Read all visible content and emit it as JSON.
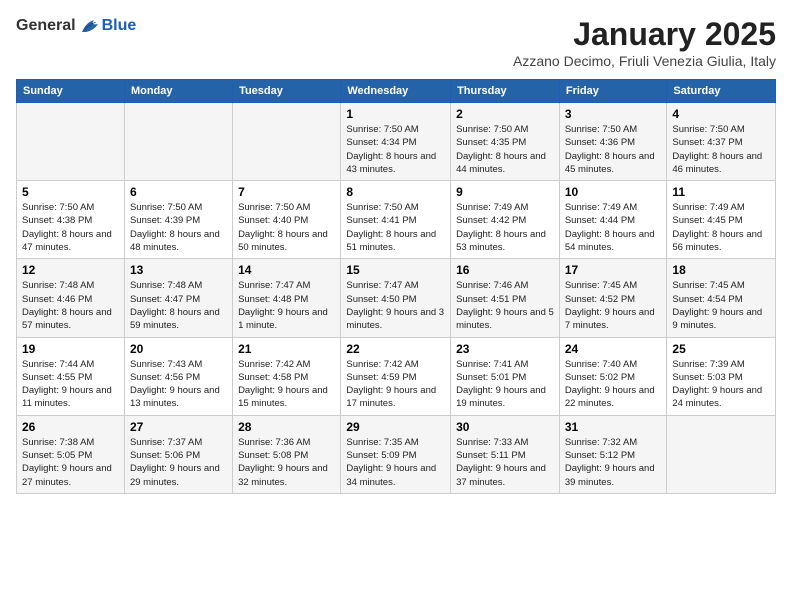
{
  "header": {
    "logo_general": "General",
    "logo_blue": "Blue",
    "month_title": "January 2025",
    "location": "Azzano Decimo, Friuli Venezia Giulia, Italy"
  },
  "weekdays": [
    "Sunday",
    "Monday",
    "Tuesday",
    "Wednesday",
    "Thursday",
    "Friday",
    "Saturday"
  ],
  "weeks": [
    [
      {
        "date": "",
        "info": ""
      },
      {
        "date": "",
        "info": ""
      },
      {
        "date": "",
        "info": ""
      },
      {
        "date": "1",
        "info": "Sunrise: 7:50 AM\nSunset: 4:34 PM\nDaylight: 8 hours and 43 minutes."
      },
      {
        "date": "2",
        "info": "Sunrise: 7:50 AM\nSunset: 4:35 PM\nDaylight: 8 hours and 44 minutes."
      },
      {
        "date": "3",
        "info": "Sunrise: 7:50 AM\nSunset: 4:36 PM\nDaylight: 8 hours and 45 minutes."
      },
      {
        "date": "4",
        "info": "Sunrise: 7:50 AM\nSunset: 4:37 PM\nDaylight: 8 hours and 46 minutes."
      }
    ],
    [
      {
        "date": "5",
        "info": "Sunrise: 7:50 AM\nSunset: 4:38 PM\nDaylight: 8 hours and 47 minutes."
      },
      {
        "date": "6",
        "info": "Sunrise: 7:50 AM\nSunset: 4:39 PM\nDaylight: 8 hours and 48 minutes."
      },
      {
        "date": "7",
        "info": "Sunrise: 7:50 AM\nSunset: 4:40 PM\nDaylight: 8 hours and 50 minutes."
      },
      {
        "date": "8",
        "info": "Sunrise: 7:50 AM\nSunset: 4:41 PM\nDaylight: 8 hours and 51 minutes."
      },
      {
        "date": "9",
        "info": "Sunrise: 7:49 AM\nSunset: 4:42 PM\nDaylight: 8 hours and 53 minutes."
      },
      {
        "date": "10",
        "info": "Sunrise: 7:49 AM\nSunset: 4:44 PM\nDaylight: 8 hours and 54 minutes."
      },
      {
        "date": "11",
        "info": "Sunrise: 7:49 AM\nSunset: 4:45 PM\nDaylight: 8 hours and 56 minutes."
      }
    ],
    [
      {
        "date": "12",
        "info": "Sunrise: 7:48 AM\nSunset: 4:46 PM\nDaylight: 8 hours and 57 minutes."
      },
      {
        "date": "13",
        "info": "Sunrise: 7:48 AM\nSunset: 4:47 PM\nDaylight: 8 hours and 59 minutes."
      },
      {
        "date": "14",
        "info": "Sunrise: 7:47 AM\nSunset: 4:48 PM\nDaylight: 9 hours and 1 minute."
      },
      {
        "date": "15",
        "info": "Sunrise: 7:47 AM\nSunset: 4:50 PM\nDaylight: 9 hours and 3 minutes."
      },
      {
        "date": "16",
        "info": "Sunrise: 7:46 AM\nSunset: 4:51 PM\nDaylight: 9 hours and 5 minutes."
      },
      {
        "date": "17",
        "info": "Sunrise: 7:45 AM\nSunset: 4:52 PM\nDaylight: 9 hours and 7 minutes."
      },
      {
        "date": "18",
        "info": "Sunrise: 7:45 AM\nSunset: 4:54 PM\nDaylight: 9 hours and 9 minutes."
      }
    ],
    [
      {
        "date": "19",
        "info": "Sunrise: 7:44 AM\nSunset: 4:55 PM\nDaylight: 9 hours and 11 minutes."
      },
      {
        "date": "20",
        "info": "Sunrise: 7:43 AM\nSunset: 4:56 PM\nDaylight: 9 hours and 13 minutes."
      },
      {
        "date": "21",
        "info": "Sunrise: 7:42 AM\nSunset: 4:58 PM\nDaylight: 9 hours and 15 minutes."
      },
      {
        "date": "22",
        "info": "Sunrise: 7:42 AM\nSunset: 4:59 PM\nDaylight: 9 hours and 17 minutes."
      },
      {
        "date": "23",
        "info": "Sunrise: 7:41 AM\nSunset: 5:01 PM\nDaylight: 9 hours and 19 minutes."
      },
      {
        "date": "24",
        "info": "Sunrise: 7:40 AM\nSunset: 5:02 PM\nDaylight: 9 hours and 22 minutes."
      },
      {
        "date": "25",
        "info": "Sunrise: 7:39 AM\nSunset: 5:03 PM\nDaylight: 9 hours and 24 minutes."
      }
    ],
    [
      {
        "date": "26",
        "info": "Sunrise: 7:38 AM\nSunset: 5:05 PM\nDaylight: 9 hours and 27 minutes."
      },
      {
        "date": "27",
        "info": "Sunrise: 7:37 AM\nSunset: 5:06 PM\nDaylight: 9 hours and 29 minutes."
      },
      {
        "date": "28",
        "info": "Sunrise: 7:36 AM\nSunset: 5:08 PM\nDaylight: 9 hours and 32 minutes."
      },
      {
        "date": "29",
        "info": "Sunrise: 7:35 AM\nSunset: 5:09 PM\nDaylight: 9 hours and 34 minutes."
      },
      {
        "date": "30",
        "info": "Sunrise: 7:33 AM\nSunset: 5:11 PM\nDaylight: 9 hours and 37 minutes."
      },
      {
        "date": "31",
        "info": "Sunrise: 7:32 AM\nSunset: 5:12 PM\nDaylight: 9 hours and 39 minutes."
      },
      {
        "date": "",
        "info": ""
      }
    ]
  ]
}
